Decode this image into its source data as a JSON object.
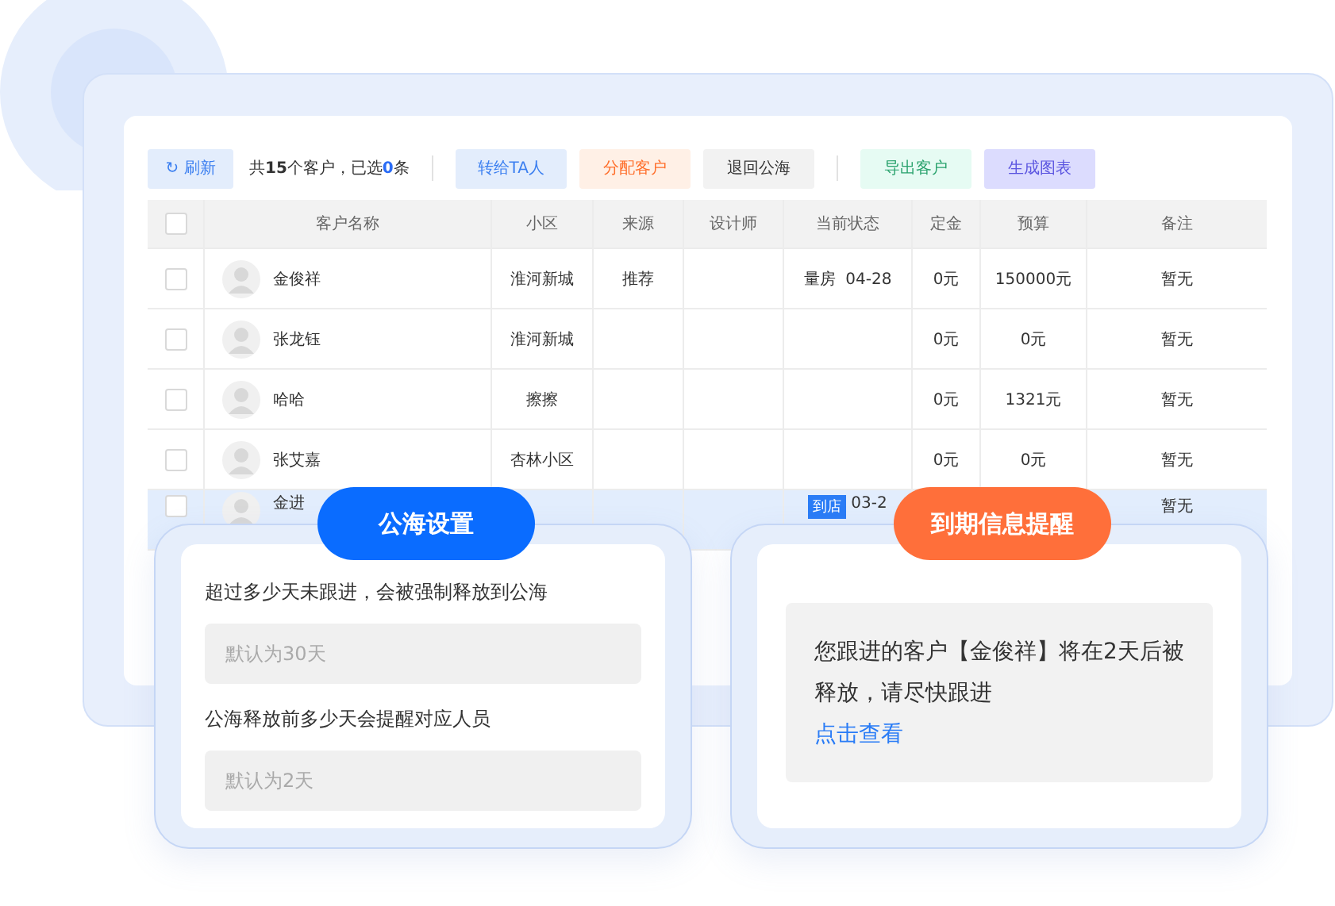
{
  "toolbar": {
    "refresh": {
      "icon": "↻",
      "label": "刷新"
    },
    "summary": [
      {
        "text": "共",
        "kind": "plain"
      },
      {
        "text": "15",
        "kind": "total"
      },
      {
        "text": "个客户，已选",
        "kind": "plain"
      },
      {
        "text": "0",
        "kind": "selected"
      },
      {
        "text": "条",
        "kind": "plain"
      }
    ],
    "groups": [
      [
        {
          "label": "转给TA人",
          "kind": "primary"
        },
        {
          "label": "分配客户",
          "kind": "warning"
        },
        {
          "label": "退回公海",
          "kind": "default"
        }
      ],
      [
        {
          "label": "导出客户",
          "kind": "success"
        },
        {
          "label": "生成图表",
          "kind": "purple"
        }
      ]
    ]
  },
  "table": {
    "all_checked": false,
    "columns": [
      "客户名称",
      "小区",
      "来源",
      "设计师",
      "当前状态",
      "定金",
      "预算",
      "备注"
    ],
    "rows": [
      {
        "name": "金俊祥",
        "community": "淮河新城",
        "source": "推荐",
        "status": "量房  04-28",
        "deposit": "0元",
        "budget": "150000元",
        "note": "暂无",
        "selected": false,
        "checked": false
      },
      {
        "name": "张龙钰",
        "community": "淮河新城",
        "deposit": "0元",
        "budget": "0元",
        "note": "暂无",
        "selected": false,
        "checked": false
      },
      {
        "name": "哈哈",
        "community": "擦擦",
        "deposit": "0元",
        "budget": "1321元",
        "note": "暂无",
        "selected": false,
        "checked": false
      },
      {
        "name": "张艾嘉",
        "community": "杏林小区",
        "deposit": "0元",
        "budget": "0元",
        "note": "暂无",
        "selected": false,
        "checked": false
      },
      {
        "name": "金进",
        "status_tag": "到店",
        "status": "03-2",
        "note": "暂无",
        "selected": true,
        "checked": false
      }
    ]
  },
  "sea_settings": {
    "title": "公海设置",
    "fields": [
      {
        "label": "超过多少天未跟进，会被强制释放到公海",
        "placeholder": "默认为30天"
      },
      {
        "label": "公海释放前多少天会提醒对应人员",
        "placeholder": "默认为2天"
      }
    ]
  },
  "expiry_reminder": {
    "title": "到期信息提醒",
    "message": "您跟进的客户【金俊祥】将在2天后被释放，请尽快跟进",
    "link": "点击查看"
  }
}
